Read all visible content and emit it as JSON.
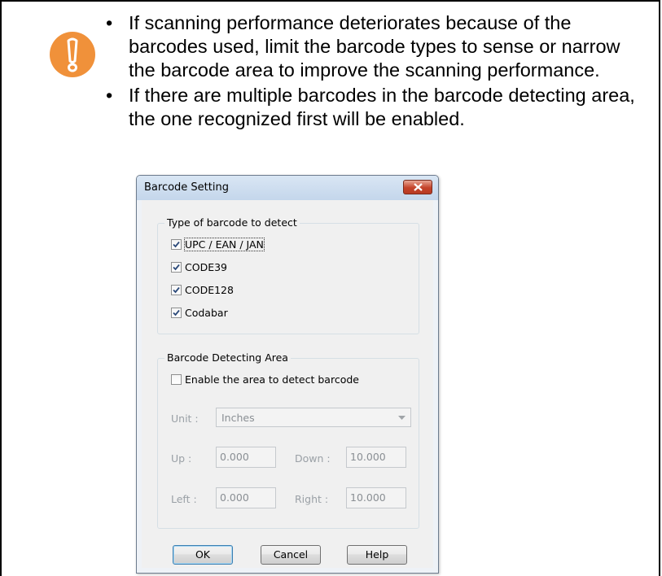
{
  "notes": [
    "If scanning performance deteriorates because of the barcodes used, limit the barcode types to sense or narrow the barcode area to improve the scanning performance.",
    "If there are multiple barcodes in the barcode detecting area, the one recognized first will be enabled."
  ],
  "bullet": "•",
  "icon": {
    "name": "caution-icon",
    "color": "#f0913a"
  },
  "dialog": {
    "title": "Barcode Setting",
    "type_group": {
      "legend": "Type of barcode to detect",
      "items": [
        {
          "label": "UPC / EAN / JAN",
          "checked": true
        },
        {
          "label": "CODE39",
          "checked": true
        },
        {
          "label": "CODE128",
          "checked": true
        },
        {
          "label": "Codabar",
          "checked": true
        }
      ]
    },
    "area_group": {
      "legend": "Barcode Detecting Area",
      "enable_label": "Enable the area to detect barcode",
      "enable_checked": false,
      "unit_label": "Unit :",
      "unit_value": "Inches",
      "up_label": "Up :",
      "up_value": "0.000",
      "down_label": "Down :",
      "down_value": "10.000",
      "left_label": "Left :",
      "left_value": "0.000",
      "right_label": "Right :",
      "right_value": "10.000"
    },
    "buttons": {
      "ok": "OK",
      "cancel": "Cancel",
      "help": "Help"
    }
  }
}
